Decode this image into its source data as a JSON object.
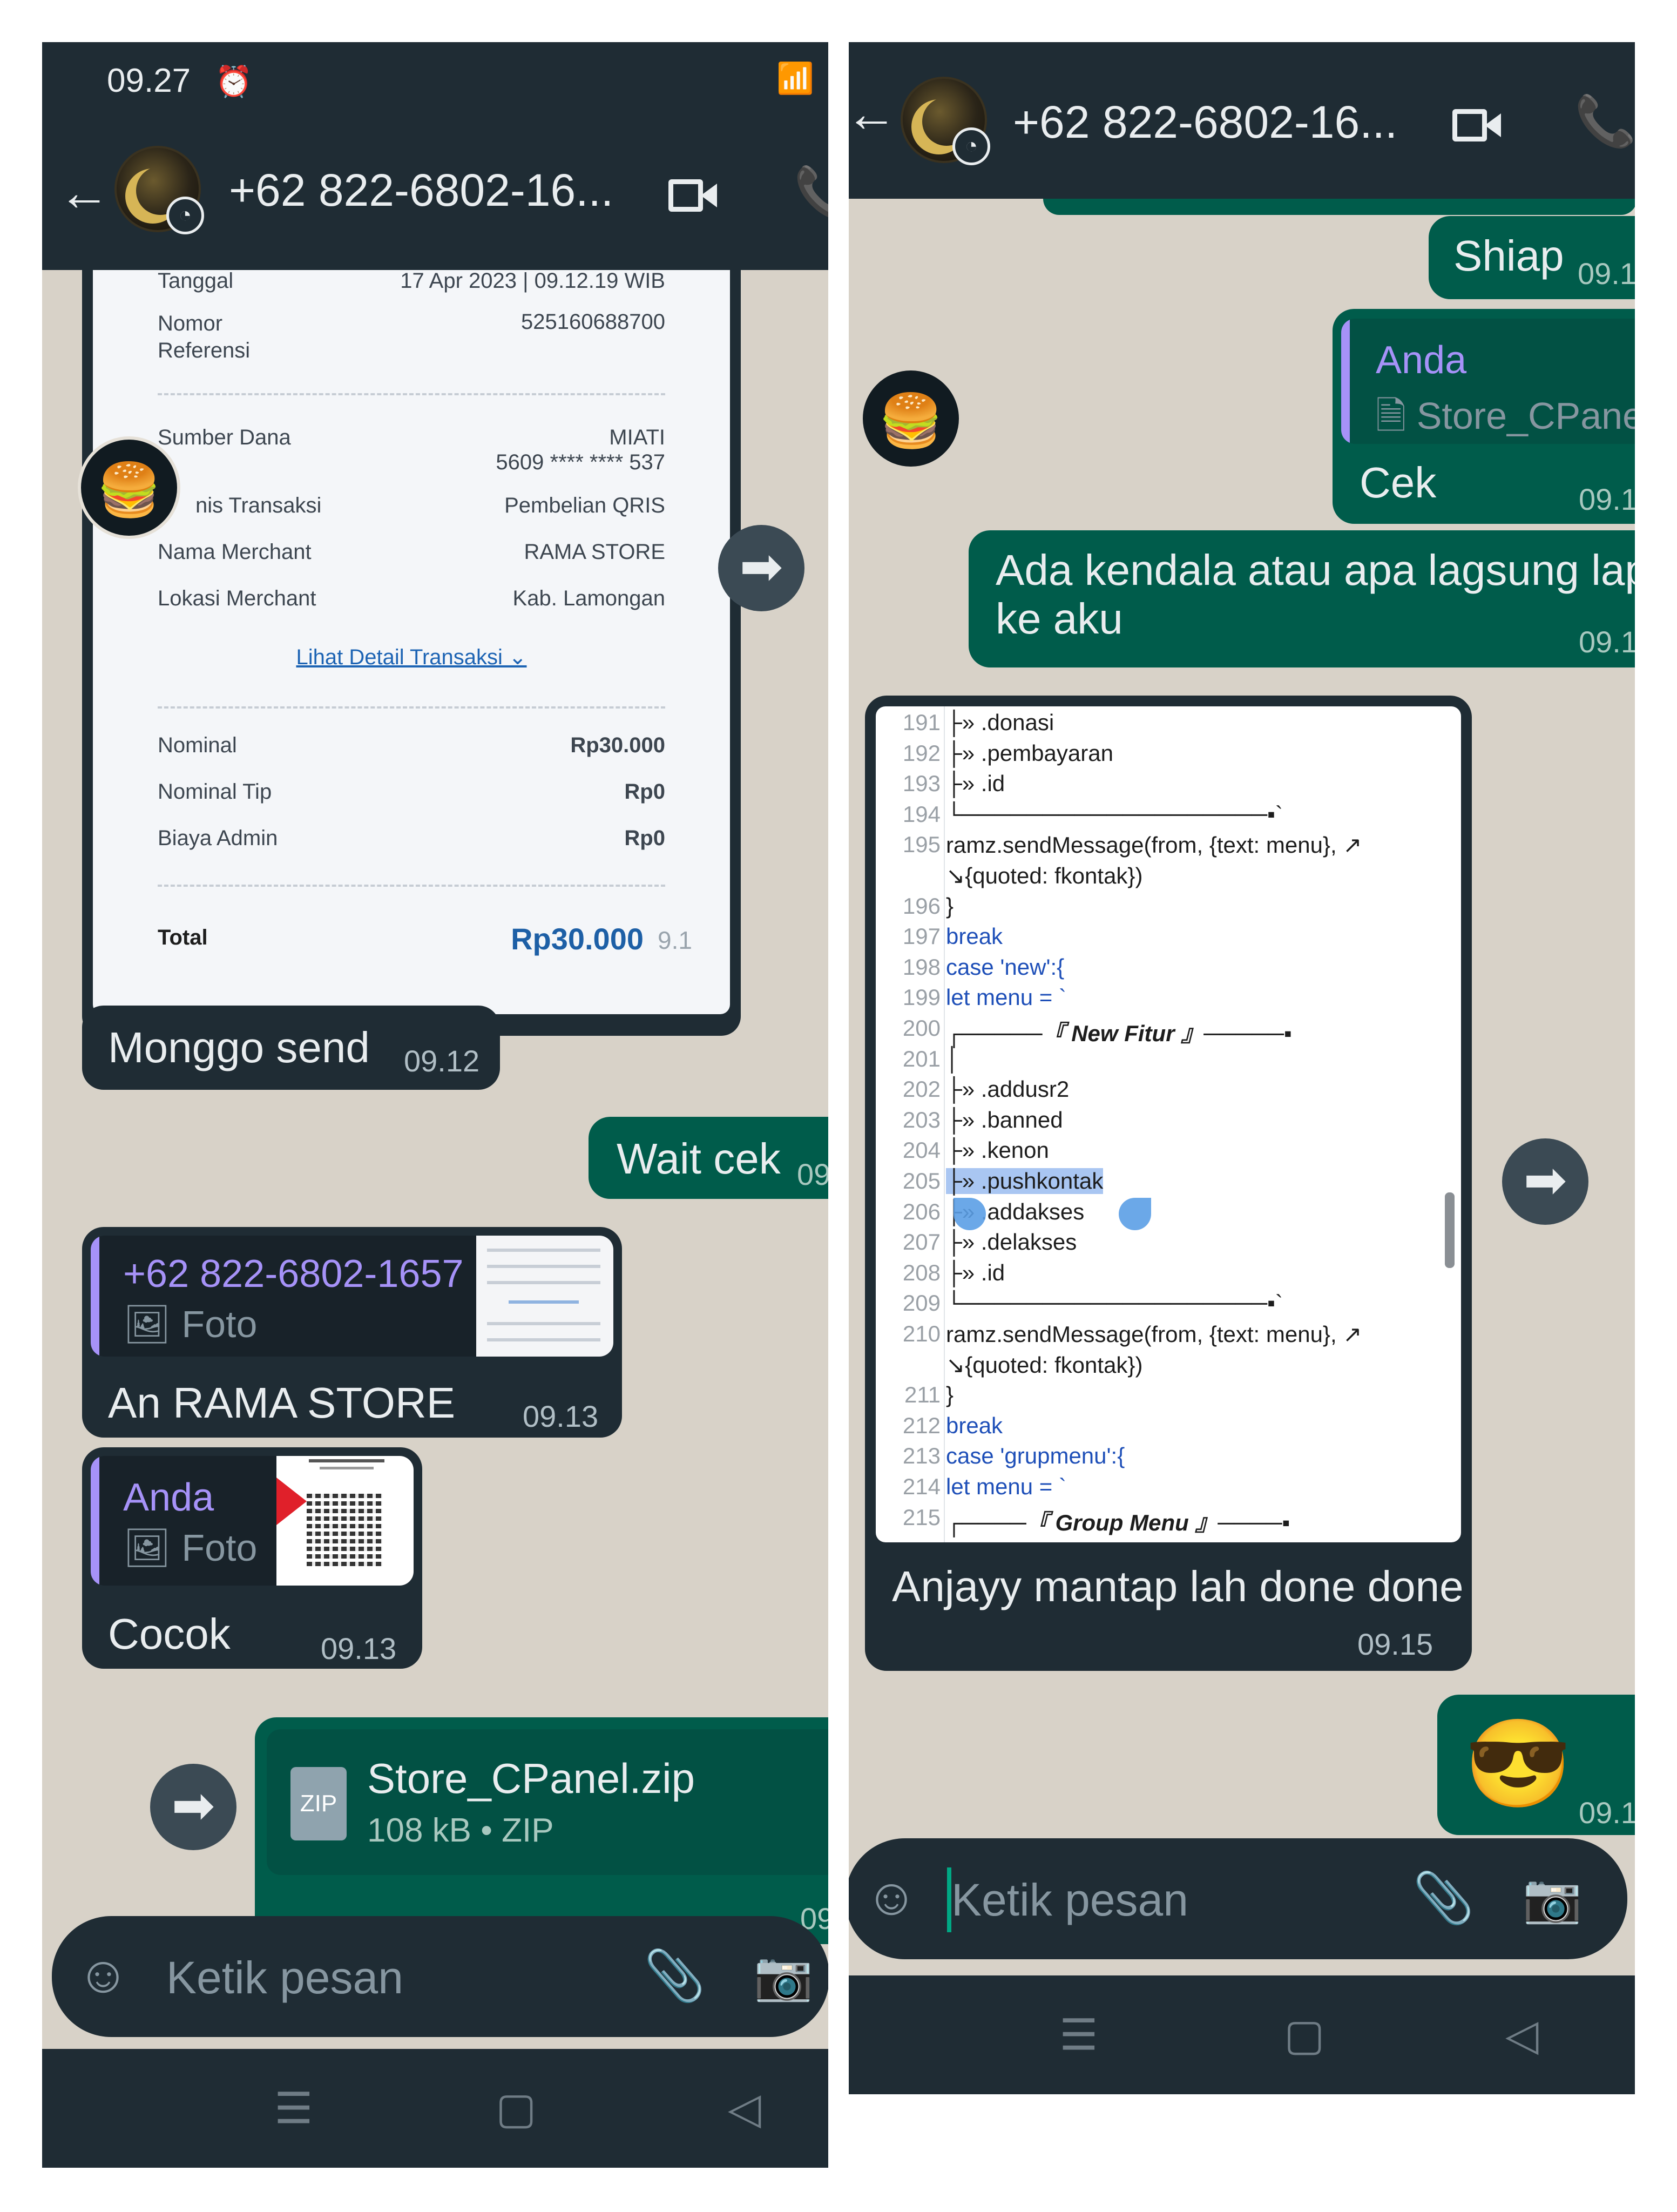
{
  "left": {
    "status": {
      "time": "09.27",
      "alarm_icon": "alarm-icon"
    },
    "header": {
      "contact": "+62 822-6802-16..."
    },
    "receipt": {
      "tanggal_label": "Tanggal",
      "tanggal_value": "17 Apr 2023 | 09.12.19 WIB",
      "ref_label": "Nomor\nReferensi",
      "ref_value": "525160688700",
      "sumber_label": "Sumber Dana",
      "sumber_name": "MIATI",
      "sumber_num": "5609 **** **** 537",
      "jenis_label": "nis Transaksi",
      "jenis_value": "Pembelian QRIS",
      "merchant_label": "Nama Merchant",
      "merchant_value": "RAMA STORE",
      "lokasi_label": "Lokasi Merchant",
      "lokasi_value": "Kab. Lamongan",
      "detail_link": "Lihat Detail Transaksi ⌄",
      "nominal_label": "Nominal",
      "nominal_value": "Rp30.000",
      "tip_label": "Nominal Tip",
      "tip_value": "Rp0",
      "admin_label": "Biaya Admin",
      "admin_value": "Rp0",
      "total_label": "Total",
      "total_value": "Rp30.000",
      "time_fragment": "9.1"
    },
    "messages": {
      "monggo": {
        "text": "Monggo send",
        "time": "09.12"
      },
      "wait": {
        "text": "Wait cek",
        "time": "09"
      },
      "rama": {
        "quote_name": "+62 822-6802-1657",
        "quote_sub": "Foto",
        "text": "An RAMA STORE",
        "time": "09.13"
      },
      "cocok": {
        "quote_name": "Anda",
        "quote_sub": "Foto",
        "text": "Cocok",
        "time": "09.13"
      },
      "file": {
        "name": "Store_CPanel.zip",
        "meta": "108 kB • ZIP",
        "icon_text": "ZIP",
        "time": "09"
      }
    },
    "input": {
      "placeholder": "Ketik pesan"
    }
  },
  "right": {
    "header": {
      "contact": "+62 822-6802-16..."
    },
    "messages": {
      "shiap": {
        "text": "Shiap",
        "time": "09.1"
      },
      "cek": {
        "quote_name": "Anda",
        "quote_sub": "Store_CPanel",
        "text": "Cek",
        "time": "09.1"
      },
      "kendala": {
        "line1": "Ada kendala atau apa lagsung lapo",
        "line2": "ke aku",
        "time": "09.1"
      },
      "anjayy": {
        "text": "Anjayy mantap lah done done",
        "time": "09.15"
      },
      "emoji": {
        "text": "😎",
        "time": "09.1"
      }
    },
    "code_lines": [
      {
        "n": "191",
        "t": "├» .donasi"
      },
      {
        "n": "192",
        "t": "├» .pembayaran"
      },
      {
        "n": "193",
        "t": "├» .id"
      },
      {
        "n": "194",
        "t": "└───────────────────▪`"
      },
      {
        "n": "195",
        "t": "ramz.sendMessage(from, {text: menu}, ↗"
      },
      {
        "n": "",
        "t": "  ↘{quoted: fkontak})"
      },
      {
        "n": "196",
        "t": "}"
      },
      {
        "n": "197",
        "t": "break"
      },
      {
        "n": "198",
        "t": "case 'new':{"
      },
      {
        "n": "199",
        "t": "    let menu = `"
      },
      {
        "n": "200",
        "t": "┌─────『 New Fitur 』─────▪"
      },
      {
        "n": "201",
        "t": "│"
      },
      {
        "n": "202",
        "t": "├» .addusr2"
      },
      {
        "n": "203",
        "t": "├» .banned"
      },
      {
        "n": "204",
        "t": "├» .kenon"
      },
      {
        "n": "205",
        "t": "├» .pushkontak"
      },
      {
        "n": "206",
        "t": "├» .addakses"
      },
      {
        "n": "207",
        "t": "├» .delakses"
      },
      {
        "n": "208",
        "t": "├» .id"
      },
      {
        "n": "209",
        "t": "└───────────────────▪`"
      },
      {
        "n": "210",
        "t": "ramz.sendMessage(from, {text: menu}, ↗"
      },
      {
        "n": "",
        "t": "  ↘{quoted: fkontak})"
      },
      {
        "n": "211",
        "t": "}"
      },
      {
        "n": "212",
        "t": "break"
      },
      {
        "n": "213",
        "t": "case 'grupmenu':{"
      },
      {
        "n": "214",
        "t": "    let menu = `"
      },
      {
        "n": "215",
        "t": "┌────『 Group Menu 』────▪"
      }
    ],
    "input": {
      "placeholder": "Ketik pesan"
    }
  },
  "colors": {
    "incoming": "#1f2c34",
    "outgoing": "#005c4b",
    "wallpaper": "#d8d2c8",
    "accent": "#00a884",
    "quote_name": "#a692f8"
  }
}
